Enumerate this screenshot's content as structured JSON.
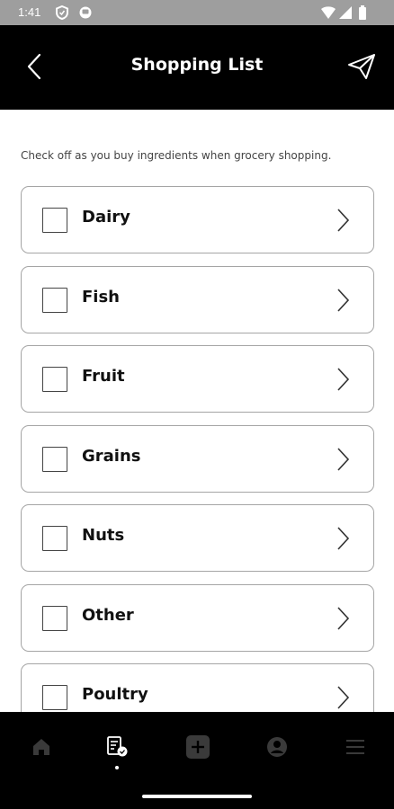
{
  "status_bar": {
    "time": "1:41"
  },
  "header": {
    "title": "Shopping List"
  },
  "main": {
    "instructions": "Check off as you buy ingredients when grocery shopping.",
    "items": [
      {
        "label": "Dairy",
        "checked": false
      },
      {
        "label": "Fish",
        "checked": false
      },
      {
        "label": "Fruit",
        "checked": false
      },
      {
        "label": "Grains",
        "checked": false
      },
      {
        "label": "Nuts",
        "checked": false
      },
      {
        "label": "Other",
        "checked": false
      },
      {
        "label": "Poultry",
        "checked": false
      }
    ]
  },
  "bottom_nav": {
    "items": [
      {
        "icon": "home-icon",
        "active": false
      },
      {
        "icon": "shopping-list-icon",
        "active": true
      },
      {
        "icon": "add-icon",
        "active": false
      },
      {
        "icon": "profile-icon",
        "active": false
      },
      {
        "icon": "menu-icon",
        "active": false
      }
    ]
  },
  "colors": {
    "header_bg": "#000000",
    "status_bar_bg": "#9e9e9e",
    "card_border": "#a5a5a5",
    "nav_inactive": "#3a3a3a"
  }
}
